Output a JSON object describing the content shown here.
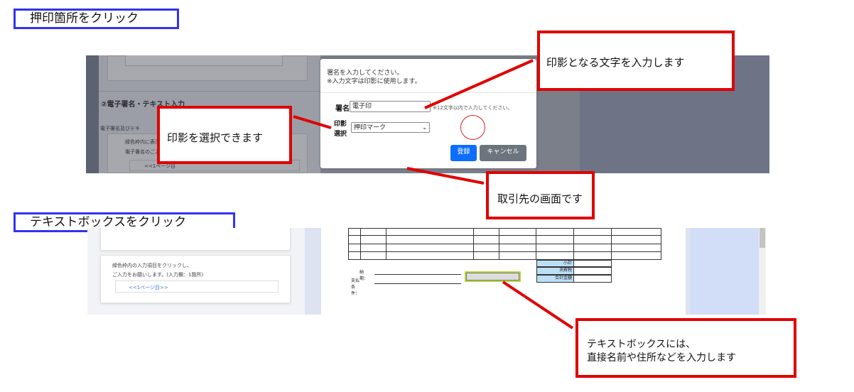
{
  "section1": {
    "title": "押印箇所をクリック"
  },
  "section2": {
    "title": "テキストボックスをクリック"
  },
  "callouts": {
    "input_text": "印影となる文字を入力します",
    "select_seal": "印影を選択できます",
    "client_screen": "取引先の画面です",
    "textbox_line1": "テキストボックスには、",
    "textbox_line2": "直接名前や住所などを入力します"
  },
  "screen1": {
    "panel_heading": "②電子署名・テキスト入力",
    "panel_text1": "電子署名及びテキ",
    "panel_text2": "緑色枠内に表示",
    "panel_text3": "電子署名のご入",
    "panel_link": "<<1ページ目",
    "modal": {
      "line1": "署名を入力してください。",
      "line2": "※入力文字は印影に使用します。",
      "sign_label": "署名",
      "sign_value": "電子印",
      "sign_hint": "※12文字以内で入力してください。",
      "seal_label_1": "印影",
      "seal_label_2": "選択",
      "seal_selected": "押印マーク",
      "register_button": "登録",
      "cancel_button": "キャンセル"
    }
  },
  "screen2": {
    "card_line1": "緑色枠内の入力項目をクリックし、",
    "card_line2": "ご入力をお願いします。(入力欄：1箇所)",
    "card_link": "<<1ページ目>>",
    "delivery_label": "納期：",
    "payment_label": "支払条件：",
    "subtotal": "小計",
    "tax": "消費税",
    "total": "合計金額"
  },
  "colors": {
    "callout_border": "#e00000",
    "header_border": "#3333ee",
    "primary": "#0d6efd",
    "secondary": "#6c757d"
  }
}
